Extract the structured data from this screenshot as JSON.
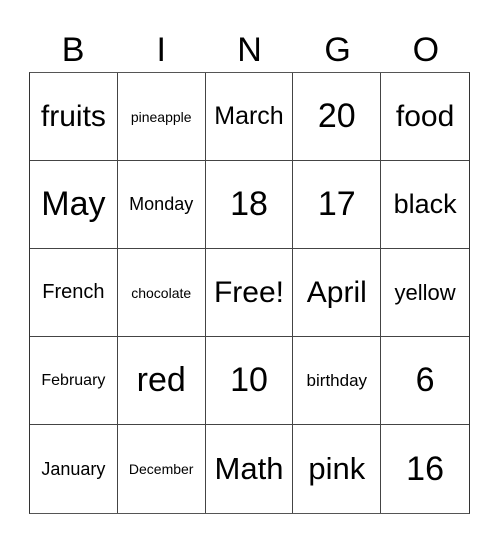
{
  "header": {
    "letters": [
      "B",
      "I",
      "N",
      "G",
      "O"
    ]
  },
  "board": {
    "rows": [
      [
        "fruits",
        "pineapple",
        "March",
        "20",
        "food"
      ],
      [
        "May",
        "Monday",
        "18",
        "17",
        "black"
      ],
      [
        "French",
        "chocolate",
        "Free!",
        "April",
        "yellow"
      ],
      [
        "February",
        "red",
        "10",
        "birthday",
        "6"
      ],
      [
        "January",
        "December",
        "Math",
        "pink",
        "16"
      ]
    ],
    "free_space": "Free!"
  },
  "colors": {
    "background": "#ffffff",
    "text": "#000000",
    "grid_lines": "#444444"
  }
}
